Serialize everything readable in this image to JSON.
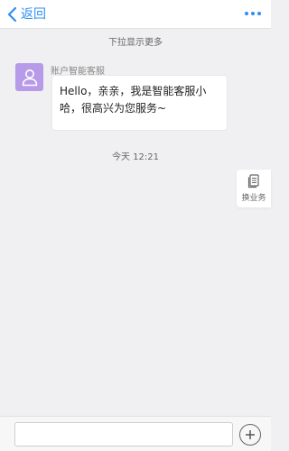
{
  "header": {
    "back_label": "返回",
    "back_icon": "chevron-left-icon",
    "more_icon": "more-dots-icon",
    "accent_color": "#2f8ff0"
  },
  "chat": {
    "pull_hint": "下拉显示更多",
    "messages": [
      {
        "sender": "账户智能客服",
        "avatar_icon": "user-icon",
        "avatar_color": "#b79ae8",
        "text": "Hello，亲亲，我是智能客服小哈，很高兴为您服务~"
      }
    ],
    "timestamp": "今天 12:21"
  },
  "side_button": {
    "label": "换业务",
    "icon": "document-icon"
  },
  "input_bar": {
    "value": "",
    "placeholder": "",
    "plus_icon": "plus-icon"
  }
}
